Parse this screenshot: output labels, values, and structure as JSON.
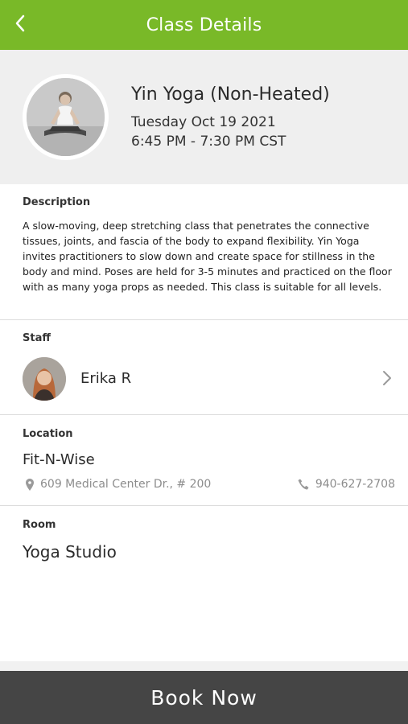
{
  "header": {
    "title": "Class Details",
    "back_icon": "chevron-left-icon"
  },
  "class": {
    "name": "Yin Yoga (Non-Heated)",
    "date": "Tuesday Oct 19 2021",
    "time": "6:45 PM - 7:30 PM CST"
  },
  "description": {
    "label": "Description",
    "text": "A slow-moving, deep stretching class that penetrates the connective tissues, joints, and fascia of the body to expand flexibility. Yin Yoga invites practitioners to slow down and create space for stillness in the body and mind. Poses are held for 3-5 minutes and practiced on the floor with as many yoga props as needed. This class is suitable for all levels."
  },
  "staff": {
    "label": "Staff",
    "name": "Erika R"
  },
  "location": {
    "label": "Location",
    "name": "Fit-N-Wise",
    "address": "609 Medical Center Dr., # 200",
    "phone": "940-627-2708"
  },
  "room": {
    "label": "Room",
    "name": "Yoga Studio"
  },
  "book": {
    "label": "Book Now"
  },
  "colors": {
    "header": "#79b928",
    "book_button": "#454545"
  }
}
